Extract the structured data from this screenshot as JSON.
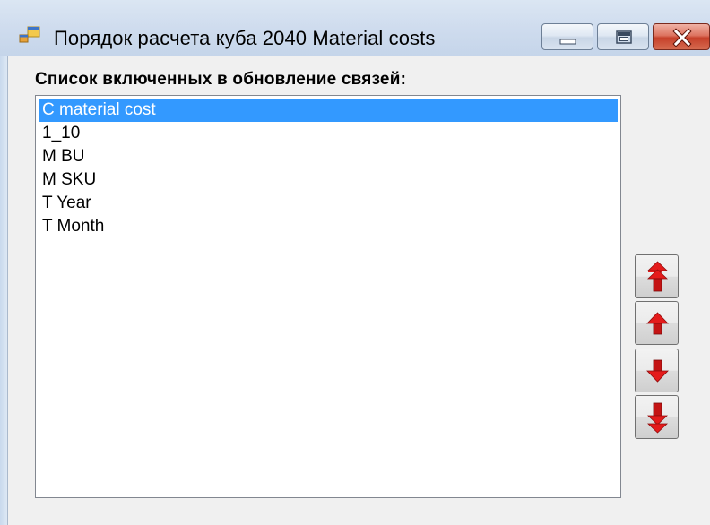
{
  "window": {
    "title": "Порядок расчета куба 2040 Material costs",
    "icons": {
      "app": "application-window-icon",
      "minimize": "minimize-icon",
      "maximize": "maximize-icon",
      "close": "close-icon"
    }
  },
  "main": {
    "list_label": "Список включенных в обновление связей:",
    "list": {
      "items": [
        "C material cost",
        "1_10",
        "M BU",
        "M SKU",
        "T Year",
        "T Month"
      ],
      "selected_index": 0
    },
    "buttons": {
      "move_top_icon": "double-arrow-up-icon",
      "move_up_icon": "arrow-up-icon",
      "move_down_icon": "arrow-down-icon",
      "move_bottom_icon": "double-arrow-down-icon"
    }
  },
  "colors": {
    "selection": "#3399ff",
    "arrow": "#e41b1b",
    "window_bg": "#f0f0f0"
  }
}
